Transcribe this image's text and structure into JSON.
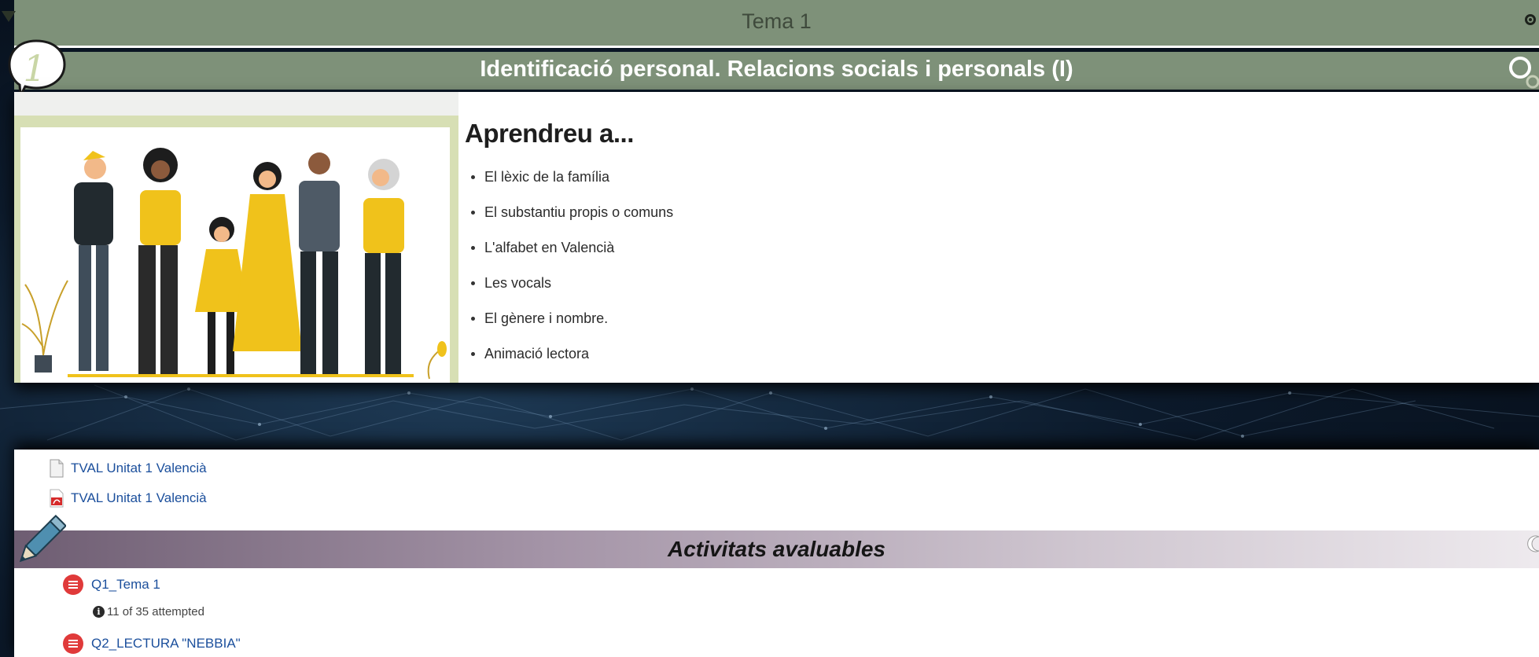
{
  "section": {
    "title": "Tema 1"
  },
  "unit": {
    "number": "1",
    "title": "Identificació personal. Relacions socials i personals (I)",
    "learn_heading": "Aprendreu a...",
    "topics": [
      "El lèxic de la família",
      "El substantiu propis o comuns",
      "L'alfabet en Valencià",
      "Les vocals",
      "El gènere i nombre.",
      "Animació lectora"
    ]
  },
  "resources": [
    {
      "label": "TVAL Unitat 1 Valencià",
      "icon": "document-icon"
    },
    {
      "label": "TVAL Unitat 1 Valencià",
      "icon": "pdf-icon"
    }
  ],
  "activities": {
    "title": "Activitats avaluables",
    "quizzes": [
      {
        "label": "Q1_Tema 1",
        "status": "11 of 35 attempted"
      },
      {
        "label": "Q2_LECTURA \"NEBBIA\""
      }
    ]
  },
  "colors": {
    "section_bar": "#7e9179",
    "activities_bar_start": "#6e5d72",
    "link": "#1b4f9c",
    "quiz_icon": "#e03a3a"
  }
}
